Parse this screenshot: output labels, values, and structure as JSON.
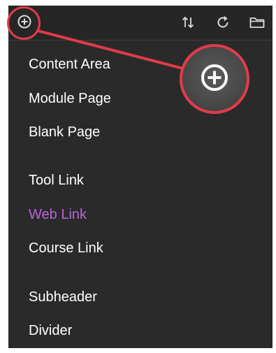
{
  "toolbar": {
    "add_icon": "plus-circle-icon",
    "reorder_icon": "up-down-arrows-icon",
    "refresh_icon": "refresh-icon",
    "folder_icon": "folder-icon"
  },
  "menu": {
    "items": [
      {
        "label": "Content Area"
      },
      {
        "label": "Module Page"
      },
      {
        "label": "Blank Page"
      },
      {
        "label": "Tool Link"
      },
      {
        "label": "Web Link",
        "state": "highlighted"
      },
      {
        "label": "Course Link"
      },
      {
        "label": "Subheader"
      },
      {
        "label": "Divider"
      }
    ]
  },
  "colors": {
    "panel_background": "#2a2a2a",
    "text": "#ffffff",
    "highlight_text": "#b866d6",
    "annotation_red": "#e23b4a"
  }
}
